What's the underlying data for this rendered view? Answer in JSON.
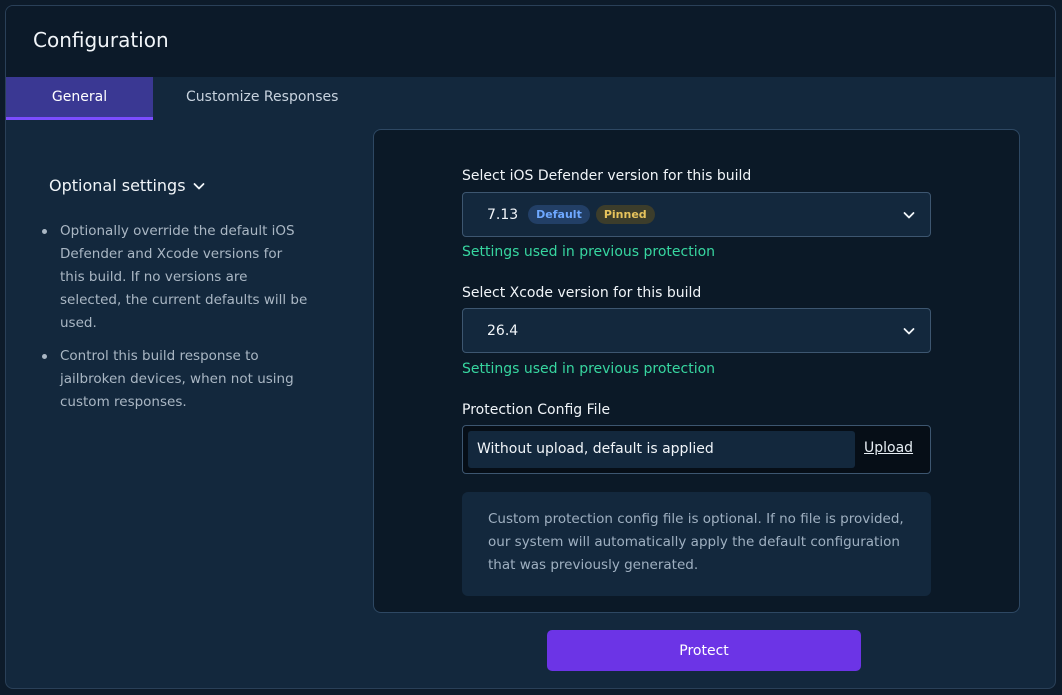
{
  "header": {
    "title": "Configuration"
  },
  "tabs": [
    {
      "label": "General"
    },
    {
      "label": "Customize Responses"
    }
  ],
  "sidebar": {
    "optional_title": "Optional settings",
    "bullets": [
      "Optionally override the default iOS Defender and Xcode versions for this build. If no versions are selected, the current defaults will be used.",
      "Control this build response to jailbroken devices, when not using custom responses."
    ]
  },
  "form": {
    "defender": {
      "label": "Select iOS Defender version for this build",
      "value": "7.13",
      "badges": [
        "Default",
        "Pinned"
      ],
      "hint": "Settings used in previous protection"
    },
    "xcode": {
      "label": "Select Xcode version for this build",
      "value": "26.4",
      "hint": "Settings used in previous protection"
    },
    "config_file": {
      "label": "Protection Config File",
      "placeholder": "Without upload, default is applied",
      "upload_label": "Upload"
    },
    "note": "Custom protection config file is optional. If no file is provided, our system will automatically apply the default configuration that was previously generated."
  },
  "actions": {
    "protect_label": "Protect"
  },
  "colors": {
    "accent": "#6c34e6",
    "tab_active": "#3a3893",
    "hint_green": "#37d6a0",
    "badge_default": "#6ea8ff",
    "badge_pinned": "#e6c35c"
  }
}
